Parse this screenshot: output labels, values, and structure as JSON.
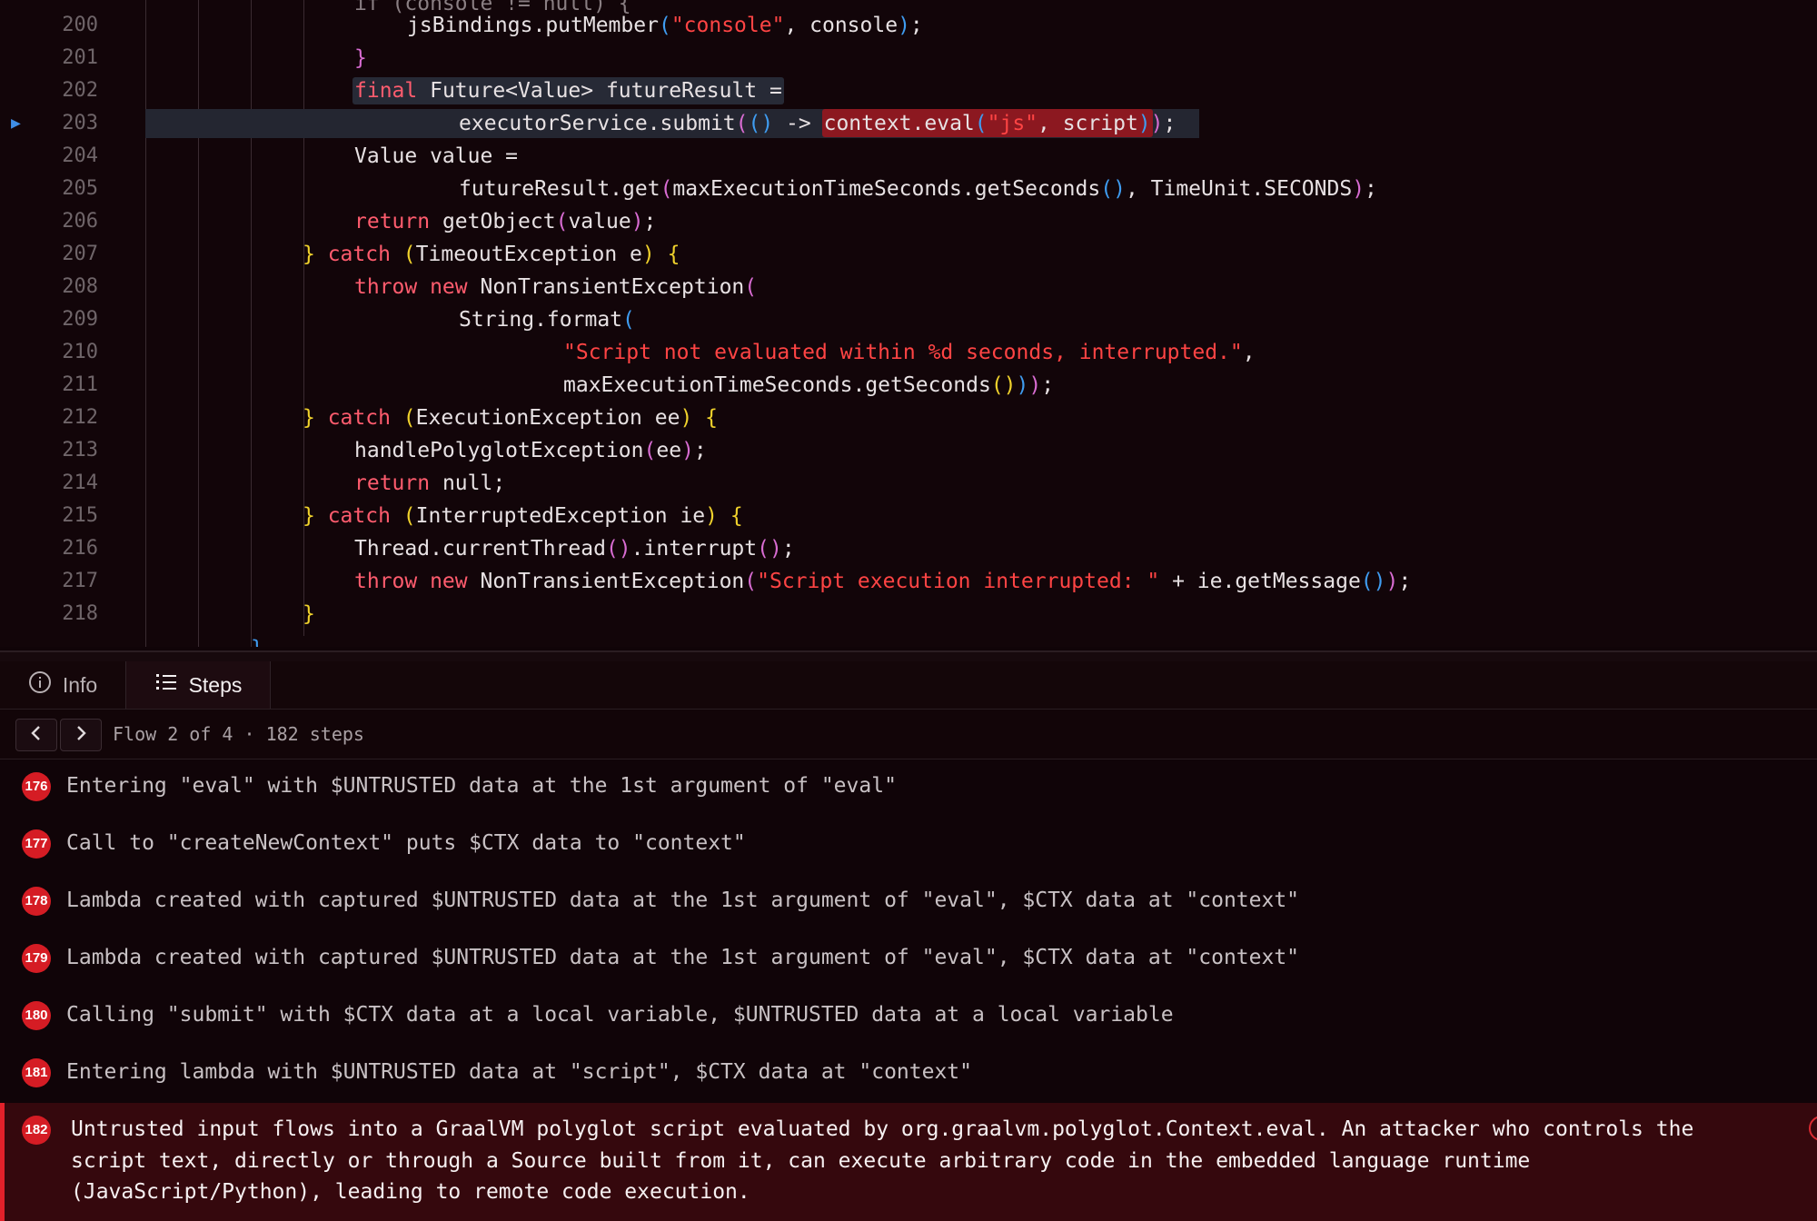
{
  "editor": {
    "lines": [
      {
        "num": "200",
        "tokens": [
          [
            "pl",
            "jsBindings.putMember"
          ],
          [
            "p3",
            "("
          ],
          [
            "str",
            "\"console\""
          ],
          [
            "pl",
            ", console"
          ],
          [
            "p3",
            ")"
          ],
          [
            "pl",
            ";"
          ]
        ],
        "indent": 448
      },
      {
        "num": "201",
        "tokens": [
          [
            "p2",
            "}"
          ]
        ],
        "indent": 390
      },
      {
        "num": "202",
        "tokens": [
          [
            "kw",
            "final"
          ],
          [
            "pl",
            " Future<Value> futureResult ="
          ]
        ],
        "indent": 390
      },
      {
        "num": "203",
        "tokens": [
          [
            "pl",
            "executorService.submit"
          ],
          [
            "p2",
            "("
          ],
          [
            "p3",
            "()"
          ],
          [
            "pl",
            " -> "
          ],
          [
            "pl",
            "context.eval"
          ],
          [
            "p3",
            "("
          ],
          [
            "str",
            "\"js\""
          ],
          [
            "pl",
            ", script"
          ],
          [
            "p3",
            ")"
          ],
          [
            "p2",
            ")"
          ],
          [
            "pl",
            ";"
          ]
        ],
        "indent": 505
      },
      {
        "num": "204",
        "tokens": [
          [
            "pl",
            "Value value ="
          ]
        ],
        "indent": 390
      },
      {
        "num": "205",
        "tokens": [
          [
            "pl",
            "futureResult.get"
          ],
          [
            "p2",
            "("
          ],
          [
            "pl",
            "maxExecutionTimeSeconds.getSeconds"
          ],
          [
            "p3",
            "()"
          ],
          [
            "pl",
            ", TimeUnit.SECONDS"
          ],
          [
            "p2",
            ")"
          ],
          [
            "pl",
            ";"
          ]
        ],
        "indent": 505
      },
      {
        "num": "206",
        "tokens": [
          [
            "kw",
            "return"
          ],
          [
            "pl",
            " getObject"
          ],
          [
            "p2",
            "("
          ],
          [
            "pl",
            "value"
          ],
          [
            "p2",
            ")"
          ],
          [
            "pl",
            ";"
          ]
        ],
        "indent": 390
      },
      {
        "num": "207",
        "tokens": [
          [
            "p1",
            "}"
          ],
          [
            "kw",
            " catch "
          ],
          [
            "p1",
            "("
          ],
          [
            "pl",
            "TimeoutException e"
          ],
          [
            "p1",
            ")"
          ],
          [
            "pl",
            " "
          ],
          [
            "p1",
            "{"
          ]
        ],
        "indent": 333
      },
      {
        "num": "208",
        "tokens": [
          [
            "kw",
            "throw new"
          ],
          [
            "pl",
            " NonTransientException"
          ],
          [
            "p2",
            "("
          ]
        ],
        "indent": 390
      },
      {
        "num": "209",
        "tokens": [
          [
            "pl",
            "String.format"
          ],
          [
            "p3",
            "("
          ]
        ],
        "indent": 505
      },
      {
        "num": "210",
        "tokens": [
          [
            "str",
            "\"Script not evaluated within %d seconds, interrupted.\""
          ],
          [
            "pl",
            ","
          ]
        ],
        "indent": 620
      },
      {
        "num": "211",
        "tokens": [
          [
            "pl",
            "maxExecutionTimeSeconds.getSeconds"
          ],
          [
            "p1",
            "()"
          ],
          [
            "p3",
            ")"
          ],
          [
            "p2",
            ")"
          ],
          [
            "pl",
            ";"
          ]
        ],
        "indent": 620
      },
      {
        "num": "212",
        "tokens": [
          [
            "p1",
            "}"
          ],
          [
            "kw",
            " catch "
          ],
          [
            "p1",
            "("
          ],
          [
            "pl",
            "ExecutionException ee"
          ],
          [
            "p1",
            ")"
          ],
          [
            "pl",
            " "
          ],
          [
            "p1",
            "{"
          ]
        ],
        "indent": 333
      },
      {
        "num": "213",
        "tokens": [
          [
            "pl",
            "handlePolyglotException"
          ],
          [
            "p2",
            "("
          ],
          [
            "pl",
            "ee"
          ],
          [
            "p2",
            ")"
          ],
          [
            "pl",
            ";"
          ]
        ],
        "indent": 390
      },
      {
        "num": "214",
        "tokens": [
          [
            "kw",
            "return"
          ],
          [
            "pl",
            " null;"
          ]
        ],
        "indent": 390
      },
      {
        "num": "215",
        "tokens": [
          [
            "p1",
            "}"
          ],
          [
            "kw",
            " catch "
          ],
          [
            "p1",
            "("
          ],
          [
            "pl",
            "InterruptedException ie"
          ],
          [
            "p1",
            ")"
          ],
          [
            "pl",
            " "
          ],
          [
            "p1",
            "{"
          ]
        ],
        "indent": 333
      },
      {
        "num": "216",
        "tokens": [
          [
            "pl",
            "Thread.currentThread"
          ],
          [
            "p2",
            "()"
          ],
          [
            "pl",
            ".interrupt"
          ],
          [
            "p2",
            "()"
          ],
          [
            "pl",
            ";"
          ]
        ],
        "indent": 390
      },
      {
        "num": "217",
        "tokens": [
          [
            "kw",
            "throw new"
          ],
          [
            "pl",
            " NonTransientException"
          ],
          [
            "p2",
            "("
          ],
          [
            "str",
            "\"Script execution interrupted: \""
          ],
          [
            "pl",
            " + ie.getMessage"
          ],
          [
            "p3",
            "()"
          ],
          [
            "p2",
            ")"
          ],
          [
            "pl",
            ";"
          ]
        ],
        "indent": 390
      },
      {
        "num": "218",
        "tokens": [
          [
            "p1",
            "}"
          ]
        ],
        "indent": 333
      }
    ]
  },
  "panel": {
    "tabs": [
      {
        "label": "Info",
        "icon": "info-icon"
      },
      {
        "label": "Steps",
        "icon": "list-icon"
      }
    ],
    "flow_label": "Flow 2 of 4 · 182 steps",
    "steps": [
      {
        "n": "176",
        "text": "Entering \"eval\" with $UNTRUSTED data at the 1st argument of \"eval\""
      },
      {
        "n": "177",
        "text": "Call to \"createNewContext\" puts $CTX data to \"context\""
      },
      {
        "n": "178",
        "text": "Lambda created with captured $UNTRUSTED data at the 1st argument of \"eval\", $CTX data at \"context\""
      },
      {
        "n": "179",
        "text": "Lambda created with captured $UNTRUSTED data at the 1st argument of \"eval\", $CTX data at \"context\""
      },
      {
        "n": "180",
        "text": "Calling \"submit\" with $CTX data at a local variable, $UNTRUSTED data at a local variable"
      },
      {
        "n": "181",
        "text": "Entering lambda with $UNTRUSTED data at \"script\", $CTX data at \"context\""
      },
      {
        "n": "182",
        "text": "Untrusted input flows into a GraalVM polyglot script evaluated by org.graalvm.polyglot.Context.eval. An attacker who controls the script text, directly or through a Source built from it, can execute arbitrary code in the embedded language runtime (JavaScript/Python), leading to remote code execution."
      }
    ],
    "selected_step": "182"
  },
  "colors": {
    "accent": "#d51c24",
    "background": "#120509"
  }
}
